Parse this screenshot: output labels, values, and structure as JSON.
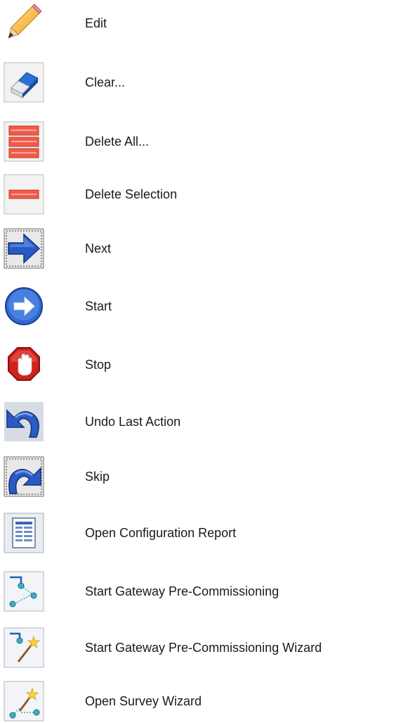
{
  "items": [
    {
      "label": "Edit",
      "icon": "pencil-icon"
    },
    {
      "label": "Clear...",
      "icon": "eraser-icon"
    },
    {
      "label": "Delete All...",
      "icon": "delete-all-icon"
    },
    {
      "label": "Delete Selection",
      "icon": "delete-selection-icon"
    },
    {
      "label": "Next",
      "icon": "next-arrow-icon"
    },
    {
      "label": "Start",
      "icon": "start-icon"
    },
    {
      "label": "Stop",
      "icon": "stop-hand-icon"
    },
    {
      "label": "Undo Last Action",
      "icon": "undo-icon"
    },
    {
      "label": "Skip",
      "icon": "skip-icon"
    },
    {
      "label": "Open Configuration Report",
      "icon": "report-icon"
    },
    {
      "label": "Start Gateway Pre-Commissioning",
      "icon": "gateway-precommissioning-icon"
    },
    {
      "label": "Start Gateway Pre-Commissioning Wizard",
      "icon": "gateway-wizard-icon"
    },
    {
      "label": "Open Survey Wizard",
      "icon": "survey-wizard-icon"
    }
  ]
}
